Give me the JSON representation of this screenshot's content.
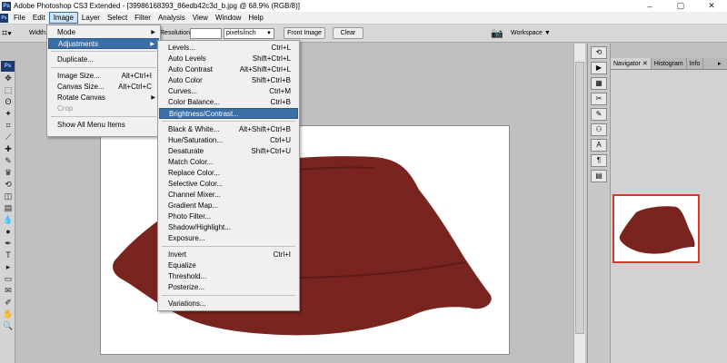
{
  "window": {
    "title": "Adobe Photoshop CS3 Extended - [39986168393_86edb42c3d_b.jpg @ 68.9% (RGB/8)]",
    "logo": "Ps",
    "controls": [
      "–",
      "▢",
      "✕"
    ]
  },
  "menubar": {
    "items": [
      "File",
      "Edit",
      "Image",
      "Layer",
      "Select",
      "Filter",
      "Analysis",
      "View",
      "Window",
      "Help"
    ],
    "active": "Image"
  },
  "options": {
    "width_label": "Width:",
    "resolution_label": "Resolution:",
    "resolution_value": "",
    "unit": "pixels/inch",
    "front_image": "Front Image",
    "clear": "Clear",
    "workspace": "Workspace ▼"
  },
  "image_menu": {
    "items": [
      {
        "label": "Mode",
        "submenu": true
      },
      {
        "label": "Adjustments",
        "submenu": true,
        "highlighted": true
      },
      {
        "label": "Duplicate..."
      },
      {
        "label": "Image Size...",
        "shortcut": "Alt+Ctrl+I"
      },
      {
        "label": "Canvas Size...",
        "shortcut": "Alt+Ctrl+C"
      },
      {
        "label": "Rotate Canvas",
        "submenu": true
      },
      {
        "label": "Crop",
        "disabled": true
      },
      {
        "label": "Show All Menu Items"
      }
    ]
  },
  "adjustments_menu": {
    "items": [
      {
        "label": "Levels...",
        "shortcut": "Ctrl+L"
      },
      {
        "label": "Auto Levels",
        "shortcut": "Shift+Ctrl+L"
      },
      {
        "label": "Auto Contrast",
        "shortcut": "Alt+Shift+Ctrl+L"
      },
      {
        "label": "Auto Color",
        "shortcut": "Shift+Ctrl+B"
      },
      {
        "label": "Curves...",
        "shortcut": "Ctrl+M"
      },
      {
        "label": "Color Balance...",
        "shortcut": "Ctrl+B"
      },
      {
        "label": "Brightness/Contrast...",
        "highlighted": true
      },
      {
        "label": "Black & White...",
        "shortcut": "Alt+Shift+Ctrl+B"
      },
      {
        "label": "Hue/Saturation...",
        "shortcut": "Ctrl+U"
      },
      {
        "label": "Desaturate",
        "shortcut": "Shift+Ctrl+U"
      },
      {
        "label": "Match Color..."
      },
      {
        "label": "Replace Color..."
      },
      {
        "label": "Selective Color..."
      },
      {
        "label": "Channel Mixer..."
      },
      {
        "label": "Gradient Map..."
      },
      {
        "label": "Photo Filter..."
      },
      {
        "label": "Shadow/Highlight..."
      },
      {
        "label": "Exposure..."
      },
      {
        "label": "Invert",
        "shortcut": "Ctrl+I"
      },
      {
        "label": "Equalize"
      },
      {
        "label": "Threshold..."
      },
      {
        "label": "Posterize..."
      },
      {
        "label": "Variations..."
      }
    ]
  },
  "panel": {
    "tabs": [
      "Navigator",
      "Histogram",
      "Info"
    ],
    "close_glyph": "✕"
  },
  "tools": {
    "icons": [
      "move-icon",
      "marquee-icon",
      "lasso-icon",
      "magic-wand-icon",
      "crop-icon",
      "slice-icon",
      "healing-brush-icon",
      "brush-icon",
      "clone-stamp-icon",
      "history-brush-icon",
      "eraser-icon",
      "gradient-icon",
      "blur-icon",
      "dodge-icon",
      "pen-icon",
      "type-icon",
      "path-selection-icon",
      "shape-icon",
      "notes-icon",
      "eyedropper-icon",
      "hand-icon",
      "zoom-icon"
    ],
    "glyphs": [
      "✥",
      "⬚",
      "ʘ",
      "✦",
      "⌗",
      "⟋",
      "✚",
      "✎",
      "♛",
      "⟲",
      "◫",
      "▤",
      "💧",
      "●",
      "✒",
      "T",
      "▸",
      "▭",
      "✉",
      "✐",
      "✋",
      "🔍"
    ]
  },
  "colors": {
    "skirt": "#7a2420",
    "highlight": "#3a6ea5",
    "nav_border": "#cf3a2a"
  }
}
